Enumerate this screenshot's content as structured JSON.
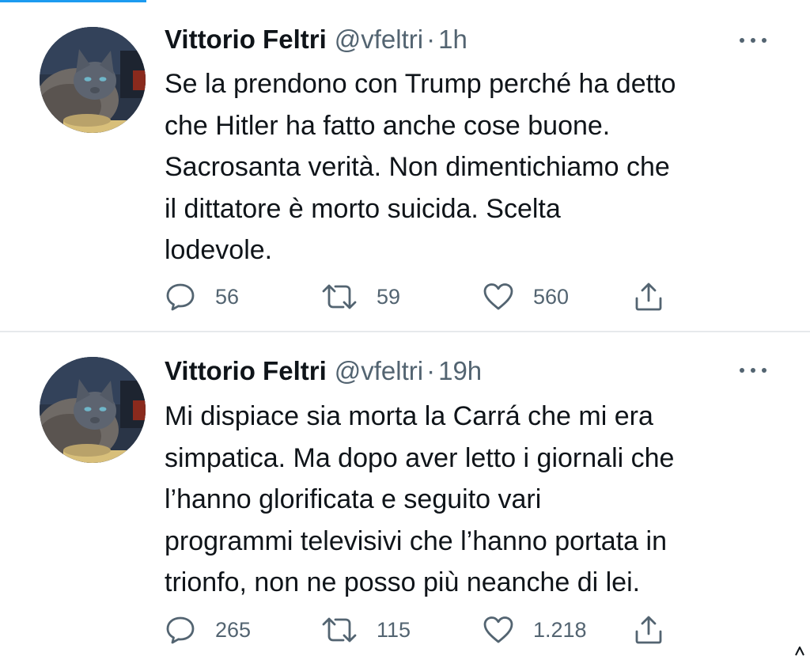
{
  "tweets": [
    {
      "author": {
        "name": "Vittorio Feltri",
        "handle": "@vfeltri",
        "separator": "·",
        "time": "1h",
        "avatar_icon": "cat-avatar-icon"
      },
      "text": "Se la prendono con Trump perché ha detto\nche Hitler ha fatto anche cose buone.\nSacrosanta verità. Non dimentichiamo che\nil dittatore è morto suicida. Scelta\nlodevole.",
      "stats": {
        "replies": "56",
        "retweets": "59",
        "likes": "560"
      }
    },
    {
      "author": {
        "name": "Vittorio Feltri",
        "handle": "@vfeltri",
        "separator": "·",
        "time": "19h",
        "avatar_icon": "cat-avatar-icon"
      },
      "text": "Mi dispiace sia morta la Carrá che mi era\nsimpatica. Ma dopo aver letto i giornali che\nl’hanno glorificata e seguito vari\nprogrammi televisivi che l’hanno portata in\ntrionfo, non ne posso più neanche di lei.",
      "stats": {
        "replies": "265",
        "retweets": "115",
        "likes": "1.218"
      }
    }
  ],
  "colors": {
    "text_primary": "#0f1419",
    "text_secondary": "#536471",
    "accent": "#1d9bf0",
    "divider": "#e6e9ec"
  },
  "icons": {
    "more": "more-horizontal-icon",
    "reply": "reply-bubble-icon",
    "retweet": "retweet-icon",
    "like": "heart-icon",
    "share": "share-icon"
  }
}
